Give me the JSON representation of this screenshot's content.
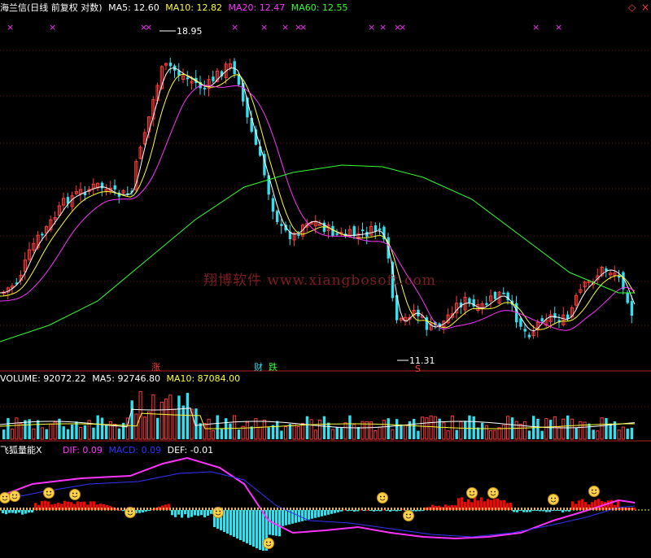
{
  "main_header": {
    "title": "海兰信(日线 前复权 对数)",
    "ma5": "MA5: 12.60",
    "ma10": "MA10: 12.82",
    "ma20": "MA20: 12.47",
    "ma60": "MA60: 12.55"
  },
  "vol_header": {
    "volume": "VOLUME: 92072.22",
    "ma5": "MA5: 92746.80",
    "ma10": "MA10: 87084.00"
  },
  "ind_header": {
    "name": "飞狐量能X",
    "dif": "DIF: 0.09",
    "macd": "MACD: 0.09",
    "def": "DEF: -0.01"
  },
  "markers": {
    "zhang": "涨",
    "cai": "财",
    "die": "跌",
    "s": "S"
  },
  "watermark": "翔博软件 www.xiangbosoft.com",
  "colors": {
    "up": "#ff3b3b",
    "down": "#33e0ef",
    "ma5": "#ffffff",
    "ma10": "#ffff33",
    "ma20": "#ff33ff",
    "ma60": "#33ff33",
    "grid": "#7a1010",
    "text_label": "#ffffff",
    "dif": "#ff33ff",
    "macd": "#3333ff"
  },
  "chart_data": {
    "type": "candlestick",
    "price_axis": "log",
    "high_label": "18.95",
    "low_label": "11.31",
    "ma_values": {
      "MA5": 12.6,
      "MA10": 12.82,
      "MA20": 12.47,
      "MA60": 12.55
    },
    "volume": {
      "value": 92072.22,
      "ma5": 92746.8,
      "ma10": 87084.0
    },
    "indicator": {
      "name": "飞狐量能X",
      "DIF": 0.09,
      "MACD": 0.09,
      "DEF": -0.01
    }
  }
}
